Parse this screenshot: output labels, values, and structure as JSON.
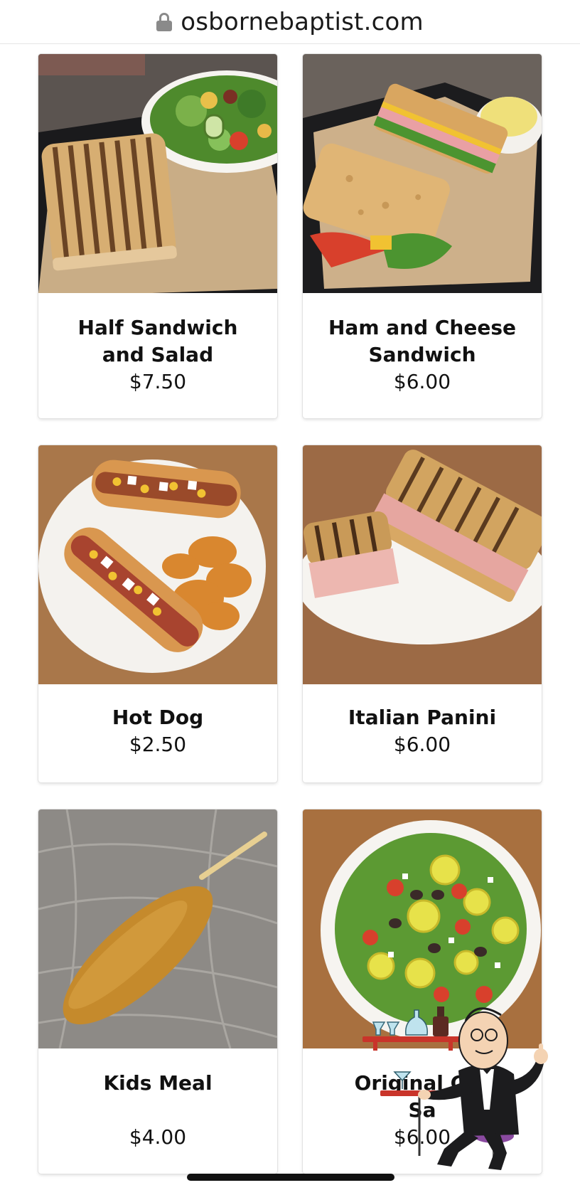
{
  "browser": {
    "url": "osbornebaptist.com",
    "lock_icon": "lock-icon"
  },
  "menu": {
    "items": [
      {
        "name_line1": "Half Sandwich",
        "name_line2": "and Salad",
        "price": "$7.50",
        "image_icon": "panini-and-salad-photo"
      },
      {
        "name_line1": "Ham and Cheese",
        "name_line2": "Sandwich",
        "price": "$6.00",
        "image_icon": "ham-and-cheese-sandwich-photo"
      },
      {
        "name_line1": "Hot Dog",
        "name_line2": "",
        "price": "$2.50",
        "image_icon": "hot-dogs-and-chips-photo"
      },
      {
        "name_line1": "Italian Panini",
        "name_line2": "",
        "price": "$6.00",
        "image_icon": "italian-panini-photo"
      },
      {
        "name_line1": "Kids Meal",
        "name_line2": "",
        "price": "$4.00",
        "image_icon": "corn-dog-photo"
      },
      {
        "name_line1": "Original Gre",
        "name_line2": "Sa",
        "price": "$6.00",
        "image_icon": "greek-salad-photo"
      }
    ]
  },
  "colors": {
    "wood": "#a9774a",
    "plate": "#f4f2ee",
    "tray": "#1c1c1e",
    "bread": "#d5a864",
    "lettuce": "#5c9a33",
    "tomato": "#d8402c"
  }
}
